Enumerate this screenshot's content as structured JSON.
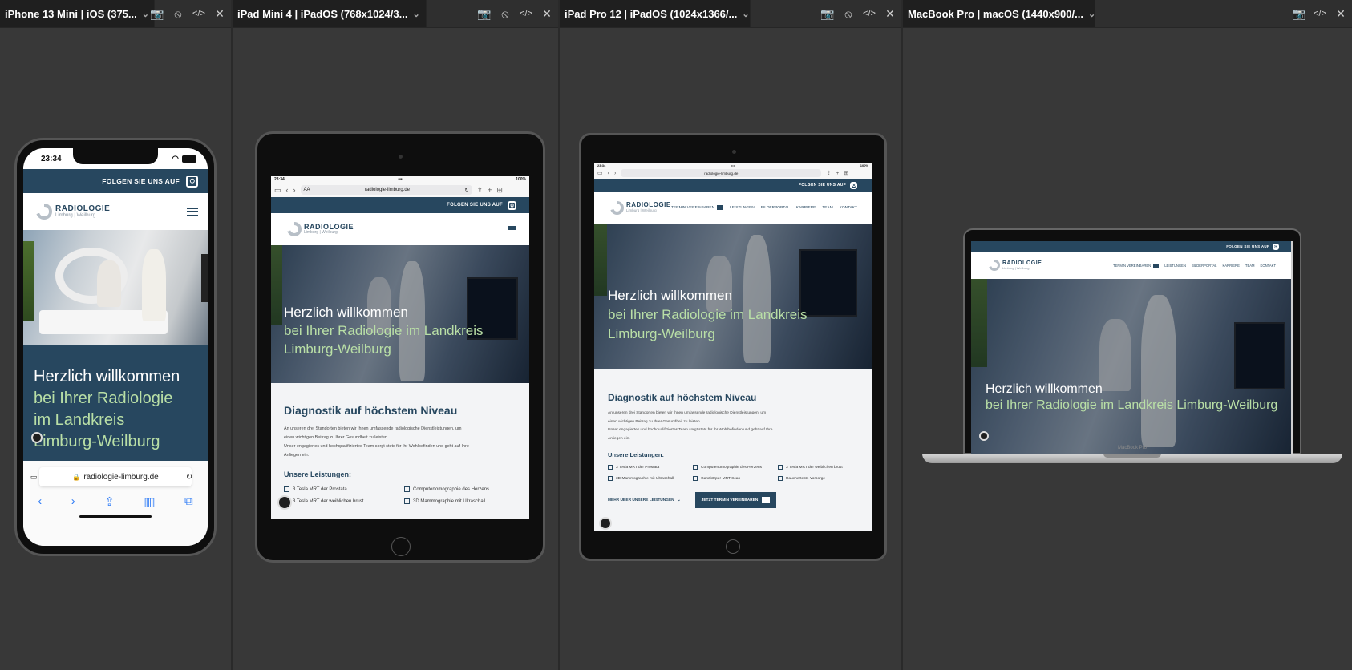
{
  "panels": [
    {
      "title": "iPhone 13 Mini | iOS (375...",
      "chev": "⌄"
    },
    {
      "title": "iPad Mini 4 | iPadOS (768x1024/3...",
      "chev": "⌄"
    },
    {
      "title": "iPad Pro 12 | iPadOS (1024x1366/...",
      "chev": "⌄"
    },
    {
      "title": "MacBook Pro | macOS (1440x900/...",
      "chev": "⌄"
    }
  ],
  "tools": {
    "camera": "📷",
    "rotate": "⦸",
    "code": "</>",
    "close": "✕"
  },
  "site": {
    "follow": "FOLGEN SIE UNS AUF",
    "logo_line1": "RADIOLOGIE",
    "logo_line2": "Limburg | Weilburg",
    "hero_line1": "Herzlich willkommen",
    "hero_line2_a": "bei Ihrer Radiologie",
    "hero_line2_b": "im Landkreis",
    "hero_line2_c": "Limburg-Weilburg",
    "hero_line2_full": "bei Ihrer Radiologie im Landkreis",
    "hero_line2_mac": "bei Ihrer Radiologie im Landkreis Limburg-Weilburg",
    "section_title": "Diagnostik auf höchstem Niveau",
    "para1": "An unseren drei Standorten bieten wir Ihnen umfassende radiologische Dienstleistungen, um",
    "para2": "einen wichtigen Beitrag zu Ihrer Gesundheit zu leisten.",
    "para3": "Unser engagiertes und hochqualifiziertes Team sorgt stets für Ihr Wohlbefinden und geht auf Ihre",
    "para4": "Anliegen ein.",
    "services_title": "Unsere Leistungen:",
    "services": [
      "3 Tesla MRT der Prostata",
      "Computertomographie des Herzens",
      "3 Tesla MRT der weiblichen brust",
      "3D Mammographie mit Ultraschall",
      "Ganzkörper-MRT Scan",
      "Rauchertests-Vorsorge"
    ],
    "more_btn": "MEHR ÜBER UNSERE LEISTUNGEN",
    "book_btn": "JETZT TERMIN VEREINBAREN",
    "nav": [
      "TERMIN VEREINBAREN",
      "LEISTUNGEN",
      "BILDERPORTAL",
      "KARRIERE",
      "TEAM",
      "KONTAKT"
    ]
  },
  "iphone": {
    "time": "23:34",
    "url": "radiologie-limburg.de"
  },
  "ipadmini": {
    "time": "23:34",
    "url": "radiologie-limburg.de",
    "aa": "AA",
    "battery": "100%"
  },
  "ipadpro": {
    "url": "radiologie-limburg.de",
    "battery": "100%"
  },
  "mac": {
    "label": "MacBook Pro"
  }
}
